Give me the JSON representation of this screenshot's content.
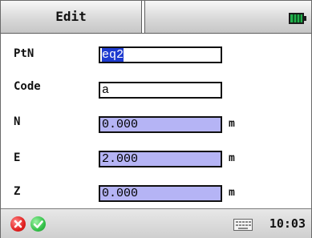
{
  "header": {
    "title": "Edit",
    "battery_icon": "battery-full-icon"
  },
  "form": {
    "ptn": {
      "label": "PtN",
      "value": "eq2",
      "selected": true
    },
    "code": {
      "label": "Code",
      "value": "a"
    },
    "n": {
      "label": "N",
      "value": "0.000",
      "unit": "m"
    },
    "e": {
      "label": "E",
      "value": "2.000",
      "unit": "m"
    },
    "z": {
      "label": "Z",
      "value": "0.000",
      "unit": "m"
    }
  },
  "footer": {
    "cancel_icon": "cancel-x-icon",
    "ok_icon": "ok-check-icon",
    "keyboard_icon": "keyboard-icon",
    "time": "10:03"
  },
  "colors": {
    "highlight_field": "#b5b4f5",
    "selection": "#1e3bd0",
    "cancel": "#e21f1f",
    "ok": "#35c24a",
    "battery": "#22b14c"
  }
}
